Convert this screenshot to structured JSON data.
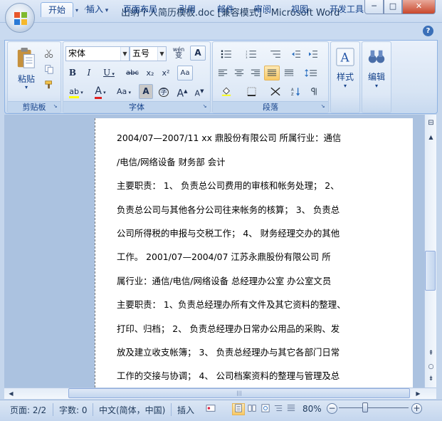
{
  "window": {
    "title": "出纳个人简历模板.doc [兼容模式] - Microsoft Word",
    "minimize_icon": "minimize-icon",
    "maximize_icon": "maximize-icon",
    "close_icon": "close-icon",
    "minimize_glyph": "─",
    "maximize_glyph": "□",
    "close_glyph": "✕"
  },
  "quick_access": {
    "save_icon": "save-icon",
    "undo_icon": "undo-icon",
    "redo_icon": "redo-icon",
    "customize_icon": "customize-qat-icon",
    "undo_glyph": "↶",
    "redo_glyph": "↷",
    "customize_glyph": "▾"
  },
  "ribbon": {
    "tabs": [
      {
        "label": "开始",
        "active": true
      },
      {
        "label": "插入"
      },
      {
        "label": "页面布局"
      },
      {
        "label": "引用"
      },
      {
        "label": "邮件"
      },
      {
        "label": "审阅"
      },
      {
        "label": "视图"
      },
      {
        "label": "开发工具"
      }
    ],
    "help_glyph": "?",
    "clipboard": {
      "label": "剪贴板",
      "paste_label": "粘贴",
      "paste_arrow": "▾"
    },
    "font": {
      "label": "字体",
      "font_name": "宋体",
      "font_size": "五号",
      "wen_glyph": "wén",
      "wen_char": "变",
      "char_border_glyph": "A",
      "bold_glyph": "B",
      "italic_glyph": "I",
      "underline_glyph": "U",
      "strike_glyph": "abc",
      "subscript_glyph": "x₂",
      "superscript_glyph": "x²",
      "clear_format_glyph": "Aa",
      "highlight_glyph": "ab",
      "font_color_glyph": "A",
      "change_case_glyph": "Aa",
      "char_shading_glyph": "A",
      "enclose_glyph": "字",
      "grow_glyph": "A",
      "shrink_glyph": "A"
    },
    "paragraph": {
      "label": "段落"
    },
    "styles": {
      "label": "样式",
      "glyph": "A"
    },
    "editing": {
      "label": "编辑",
      "glyph": "A"
    },
    "launcher_glyph": "↘"
  },
  "document": {
    "lines": [
      "2004/07—2007/11    xx 鼎股份有限公司  所属行业：通信",
      "/电信/网络设备    财务部  会计",
      "主要职责：   1、  负责总公司费用的审核和帐务处理；    2、",
      "负责总公司与其他各分公司往来帐务的核算；    3、  负责总",
      "公司所得税的申报与交税工作；    4、  财务经理交办的其他",
      "工作。    2001/07—2004/07    江苏永鼎股份有限公司  所",
      "属行业：通信/电信/网络设备    总经理办公室  办公室文员",
      "主要职责：  1、负责总经理办所有文件及其它资料的整理、",
      "打印、归档；    2、  负责总经理办日常办公用品的采购、发",
      "放及建立收支帐簿；    3、  负责总经理办与其它各部门日常",
      "工作的交接与协调；    4、  公司档案资料的整理与管理及总"
    ]
  },
  "scrollbars": {
    "up_glyph": "▲",
    "down_glyph": "▼",
    "left_glyph": "◀",
    "right_glyph": "▶",
    "prev_page_glyph": "⇞",
    "browse_glyph": "○",
    "next_page_glyph": "⇟",
    "ruler_toggle_glyph": "⊟",
    "grip_glyph": "|||"
  },
  "status": {
    "page": "页面: 2/2",
    "words": "字数: 0",
    "language": "中文(简体，中国)",
    "mode": "插入",
    "zoom": "80%",
    "zoom_out_glyph": "−",
    "zoom_in_glyph": "+",
    "views": [
      {
        "name": "print-layout-view",
        "active": true
      },
      {
        "name": "full-screen-reading-view"
      },
      {
        "name": "web-layout-view"
      },
      {
        "name": "outline-view"
      },
      {
        "name": "draft-view"
      }
    ]
  }
}
